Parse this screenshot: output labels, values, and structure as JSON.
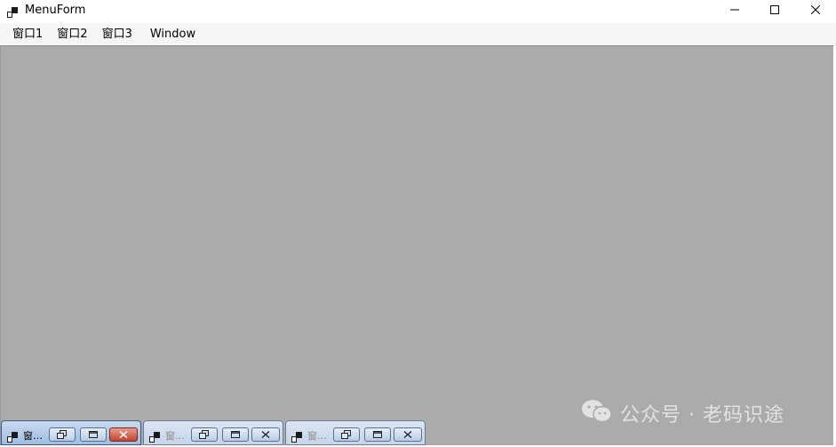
{
  "window": {
    "title": "MenuForm"
  },
  "menubar": {
    "items": [
      {
        "label": "窗口1"
      },
      {
        "label": "窗口2"
      },
      {
        "label": "窗口3"
      },
      {
        "label": "Window"
      }
    ]
  },
  "mdi": {
    "background": "#ababab",
    "minimized_children": [
      {
        "title": "窗…",
        "state": "active"
      },
      {
        "title": "窗…",
        "state": "inactive"
      },
      {
        "title": "窗…",
        "state": "inactive"
      }
    ]
  },
  "watermark": {
    "text": "公众号 · 老码识途",
    "icon": "wechat-icon"
  }
}
